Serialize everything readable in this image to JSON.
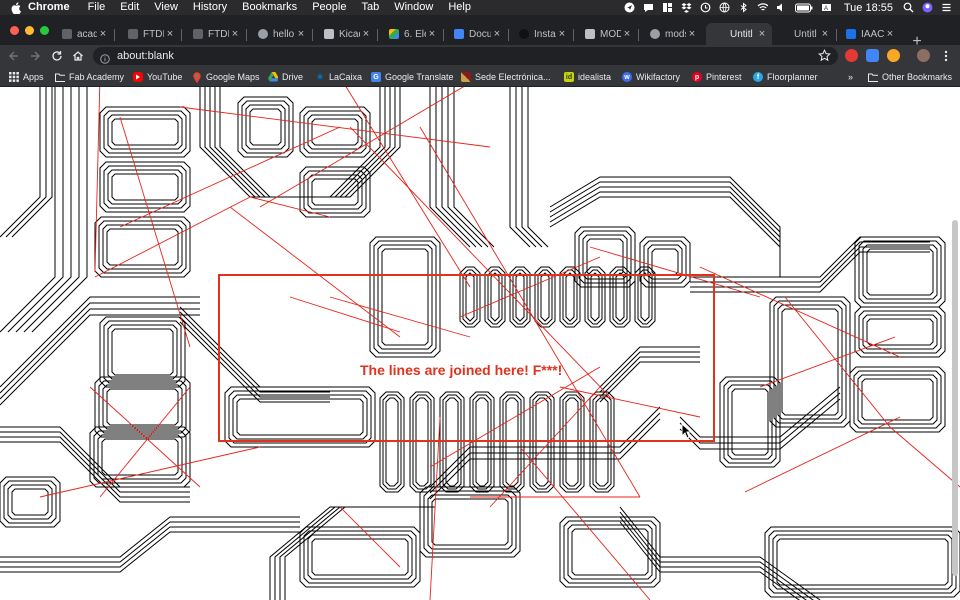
{
  "menubar": {
    "app": "Chrome",
    "items": [
      "File",
      "Edit",
      "View",
      "History",
      "Bookmarks",
      "People",
      "Tab",
      "Window",
      "Help"
    ],
    "clock": "Tue 18:55",
    "battery_icon": "battery-icon",
    "wifi_icon": "wifi-icon"
  },
  "tabs": [
    {
      "title": "acade",
      "icon": "generic-page-icon",
      "color": "#5f6368"
    },
    {
      "title": "FTDI-",
      "icon": "generic-page-icon",
      "color": "#5f6368"
    },
    {
      "title": "FTDI-",
      "icon": "generic-page-icon",
      "color": "#5f6368"
    },
    {
      "title": "hello.",
      "icon": "globe-icon",
      "color": "#9aa0a6"
    },
    {
      "title": "Kicad",
      "icon": "kicad-icon",
      "color": "#bdc1c6"
    },
    {
      "title": "6. Ele",
      "icon": "google-drive-icon",
      "color": "#fbbc04"
    },
    {
      "title": "Docu",
      "icon": "google-docs-icon",
      "color": "#4285f4"
    },
    {
      "title": "Instal",
      "icon": "github-icon",
      "color": "#111111"
    },
    {
      "title": "MODS",
      "icon": "book-icon",
      "color": "#bdc1c6"
    },
    {
      "title": "mods",
      "icon": "globe-icon",
      "color": "#9aa0a6"
    },
    {
      "title": "Untitl",
      "icon": "blank-page-icon",
      "color": "#35363a",
      "active": true
    },
    {
      "title": "Untitl",
      "icon": "blank-page-icon",
      "color": "#202124"
    },
    {
      "title": "IAAC",
      "icon": "iaac-icon",
      "color": "#1a73e8"
    }
  ],
  "toolbar": {
    "url": "about:blank",
    "back_icon": "back-arrow-icon",
    "forward_icon": "forward-arrow-icon",
    "reload_icon": "reload-icon",
    "home_icon": "home-icon",
    "bookmark_icon": "star-icon",
    "menu_icon": "kebab-menu-icon"
  },
  "bookmarks": [
    {
      "label": "Apps",
      "icon": "apps-grid-icon",
      "color": "#e8eaed"
    },
    {
      "label": "Fab Academy",
      "icon": "folder-icon",
      "color": "#e8eaed"
    },
    {
      "label": "YouTube",
      "icon": "youtube-icon",
      "color": "#ff0000"
    },
    {
      "label": "Google Maps",
      "icon": "google-maps-icon",
      "color": "#34a853"
    },
    {
      "label": "Drive",
      "icon": "google-drive-icon",
      "color": "#fbbc04"
    },
    {
      "label": "LaCaixa",
      "icon": "lacaixa-icon",
      "color": "#0074c8"
    },
    {
      "label": "Google Translate",
      "icon": "google-translate-icon",
      "color": "#4285f4"
    },
    {
      "label": "Sede Electrónica...",
      "icon": "sede-electronica-icon",
      "color": "#c8a24a"
    },
    {
      "label": "idealista",
      "icon": "idealista-icon",
      "color": "#c6d600"
    },
    {
      "label": "Wikifactory",
      "icon": "wikifactory-icon",
      "color": "#3b6ef5"
    },
    {
      "label": "Pinterest",
      "icon": "pinterest-icon",
      "color": "#e60023"
    },
    {
      "label": "Floorplanner",
      "icon": "floorplanner-icon",
      "color": "#2aa6e0"
    }
  ],
  "bookmarks_overflow": "»",
  "other_bookmarks": "Other Bookmarks",
  "content": {
    "annotation": "The lines are joined here! F***!",
    "highlight_color": "#e0321c",
    "trace_color": "#000000",
    "jump_color": "#e8231a"
  }
}
